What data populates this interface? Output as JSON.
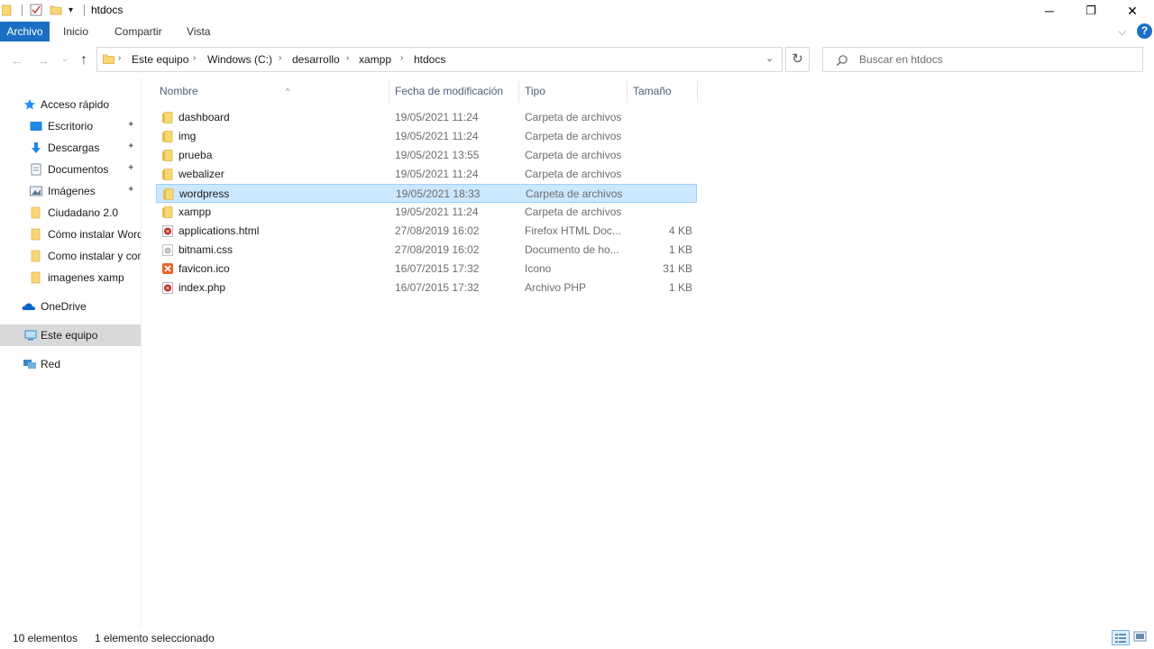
{
  "window": {
    "title": "htdocs",
    "minimize_glyph": "─",
    "maximize_glyph": "❐",
    "close_glyph": "✕"
  },
  "ribbon": {
    "tabs": [
      "Archivo",
      "Inicio",
      "Compartir",
      "Vista"
    ],
    "expand_glyph": "⌵",
    "help_glyph": "?"
  },
  "nav": {
    "back_glyph": "←",
    "forward_glyph": "→",
    "recent_glyph": "⌄",
    "up_glyph": "↑",
    "breadcrumb": [
      "Este equipo",
      "Windows (C:)",
      "desarrollo",
      "xampp",
      "htdocs"
    ],
    "crumb_separator": "›",
    "dropdown_glyph": "⌄",
    "refresh_glyph": "↻"
  },
  "search": {
    "placeholder": "Buscar en htdocs"
  },
  "sidebar": {
    "pin_glyph": "📌",
    "items": [
      {
        "label": "Acceso rápido",
        "icon": "star-icon"
      },
      {
        "label": "Escritorio",
        "icon": "desktop-icon",
        "pinned": true
      },
      {
        "label": "Descargas",
        "icon": "download-icon",
        "pinned": true
      },
      {
        "label": "Documentos",
        "icon": "document-icon",
        "pinned": true
      },
      {
        "label": "Imágenes",
        "icon": "image-icon",
        "pinned": true
      },
      {
        "label": "Ciudadano 2.0",
        "icon": "folder-icon"
      },
      {
        "label": "Cómo instalar WordPress",
        "icon": "folder-icon"
      },
      {
        "label": "Como instalar y configurar",
        "icon": "folder-icon"
      },
      {
        "label": "imagenes xamp",
        "icon": "folder-icon"
      },
      {
        "label": "OneDrive",
        "icon": "cloud-icon"
      },
      {
        "label": "Este equipo",
        "icon": "computer-icon",
        "selected": true
      },
      {
        "label": "Red",
        "icon": "network-icon"
      }
    ]
  },
  "columns": {
    "name": "Nombre",
    "date": "Fecha de modificación",
    "type": "Tipo",
    "size": "Tamaño",
    "sort_glyph": "^"
  },
  "files": [
    {
      "name": "dashboard",
      "date": "19/05/2021 11:24",
      "type": "Carpeta de archivos",
      "size": "",
      "icon": "folder-icon"
    },
    {
      "name": "img",
      "date": "19/05/2021 11:24",
      "type": "Carpeta de archivos",
      "size": "",
      "icon": "folder-icon"
    },
    {
      "name": "prueba",
      "date": "19/05/2021 13:55",
      "type": "Carpeta de archivos",
      "size": "",
      "icon": "folder-icon"
    },
    {
      "name": "webalizer",
      "date": "19/05/2021 11:24",
      "type": "Carpeta de archivos",
      "size": "",
      "icon": "folder-icon"
    },
    {
      "name": "wordpress",
      "date": "19/05/2021 18:33",
      "type": "Carpeta de archivos",
      "size": "",
      "icon": "folder-icon",
      "selected": true
    },
    {
      "name": "xampp",
      "date": "19/05/2021 11:24",
      "type": "Carpeta de archivos",
      "size": "",
      "icon": "folder-icon"
    },
    {
      "name": "applications.html",
      "date": "27/08/2019 16:02",
      "type": "Firefox HTML Doc...",
      "size": "4 KB",
      "icon": "html-file-icon"
    },
    {
      "name": "bitnami.css",
      "date": "27/08/2019 16:02",
      "type": "Documento de ho...",
      "size": "1 KB",
      "icon": "css-file-icon"
    },
    {
      "name": "favicon.ico",
      "date": "16/07/2015 17:32",
      "type": "Icono",
      "size": "31 KB",
      "icon": "ico-file-icon"
    },
    {
      "name": "index.php",
      "date": "16/07/2015 17:32",
      "type": "Archivo PHP",
      "size": "1 KB",
      "icon": "php-file-icon"
    }
  ],
  "status": {
    "count": "10 elementos",
    "selection": "1 elemento seleccionado"
  },
  "colors": {
    "accent": "#1a6fc4",
    "selection_bg": "#cce8ff",
    "selection_border": "#99d1ff",
    "folder": "#f8d775"
  }
}
